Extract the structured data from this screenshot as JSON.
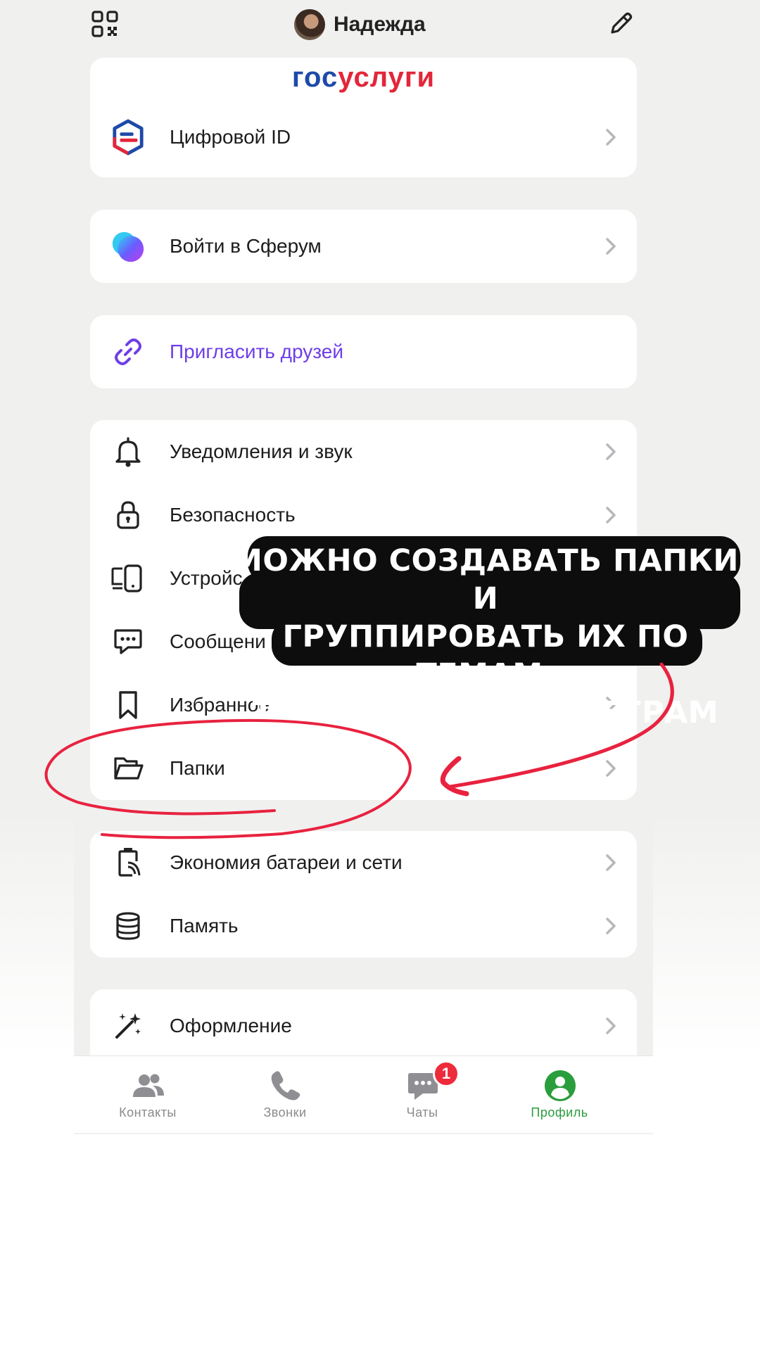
{
  "header": {
    "title": "Надежда",
    "qr_icon": "qr-code-icon",
    "edit_icon": "pencil-icon"
  },
  "gosuslugi": {
    "logo_part1": "гос",
    "logo_part2": "услуги",
    "item_label": "Цифровой ID"
  },
  "sferum": {
    "label": "Войти в Сферум"
  },
  "invite": {
    "label": "Пригласить друзей"
  },
  "settings": {
    "items": [
      {
        "label": "Уведомления и звук",
        "icon": "bell-icon"
      },
      {
        "label": "Безопасность",
        "icon": "lock-icon"
      },
      {
        "label": "Устройс",
        "icon": "devices-icon"
      },
      {
        "label": "Сообщени",
        "icon": "message-icon"
      },
      {
        "label": "Избранное",
        "icon": "bookmark-icon"
      },
      {
        "label": "Папки",
        "icon": "folder-icon"
      }
    ]
  },
  "system": {
    "items": [
      {
        "label": "Экономия батареи и сети",
        "icon": "battery-saver-icon"
      },
      {
        "label": "Память",
        "icon": "database-icon"
      }
    ]
  },
  "appearance": {
    "label": "Оформление",
    "icon": "magic-wand-icon"
  },
  "bottom_nav": {
    "tabs": [
      {
        "label": "Контакты",
        "icon": "contacts-icon"
      },
      {
        "label": "Звонки",
        "icon": "phone-icon"
      },
      {
        "label": "Чаты",
        "icon": "chat-icon",
        "badge": "1"
      },
      {
        "label": "Профиль",
        "icon": "profile-icon"
      }
    ]
  },
  "annotation": {
    "lines": [
      "МОЖНО СОЗДАВАТЬ ПАПКИ И",
      "ГРУППИРОВАТЬ ИХ ПО ТЕМАМ,",
      "ТАК ЖЕ, КАК В ТЕЛЕГРАМ"
    ]
  },
  "colors": {
    "accent_purple": "#6e3ee8",
    "active_green": "#2a9d3c",
    "badge_red": "#ee2b3a",
    "scribble_red": "#e8223f"
  }
}
